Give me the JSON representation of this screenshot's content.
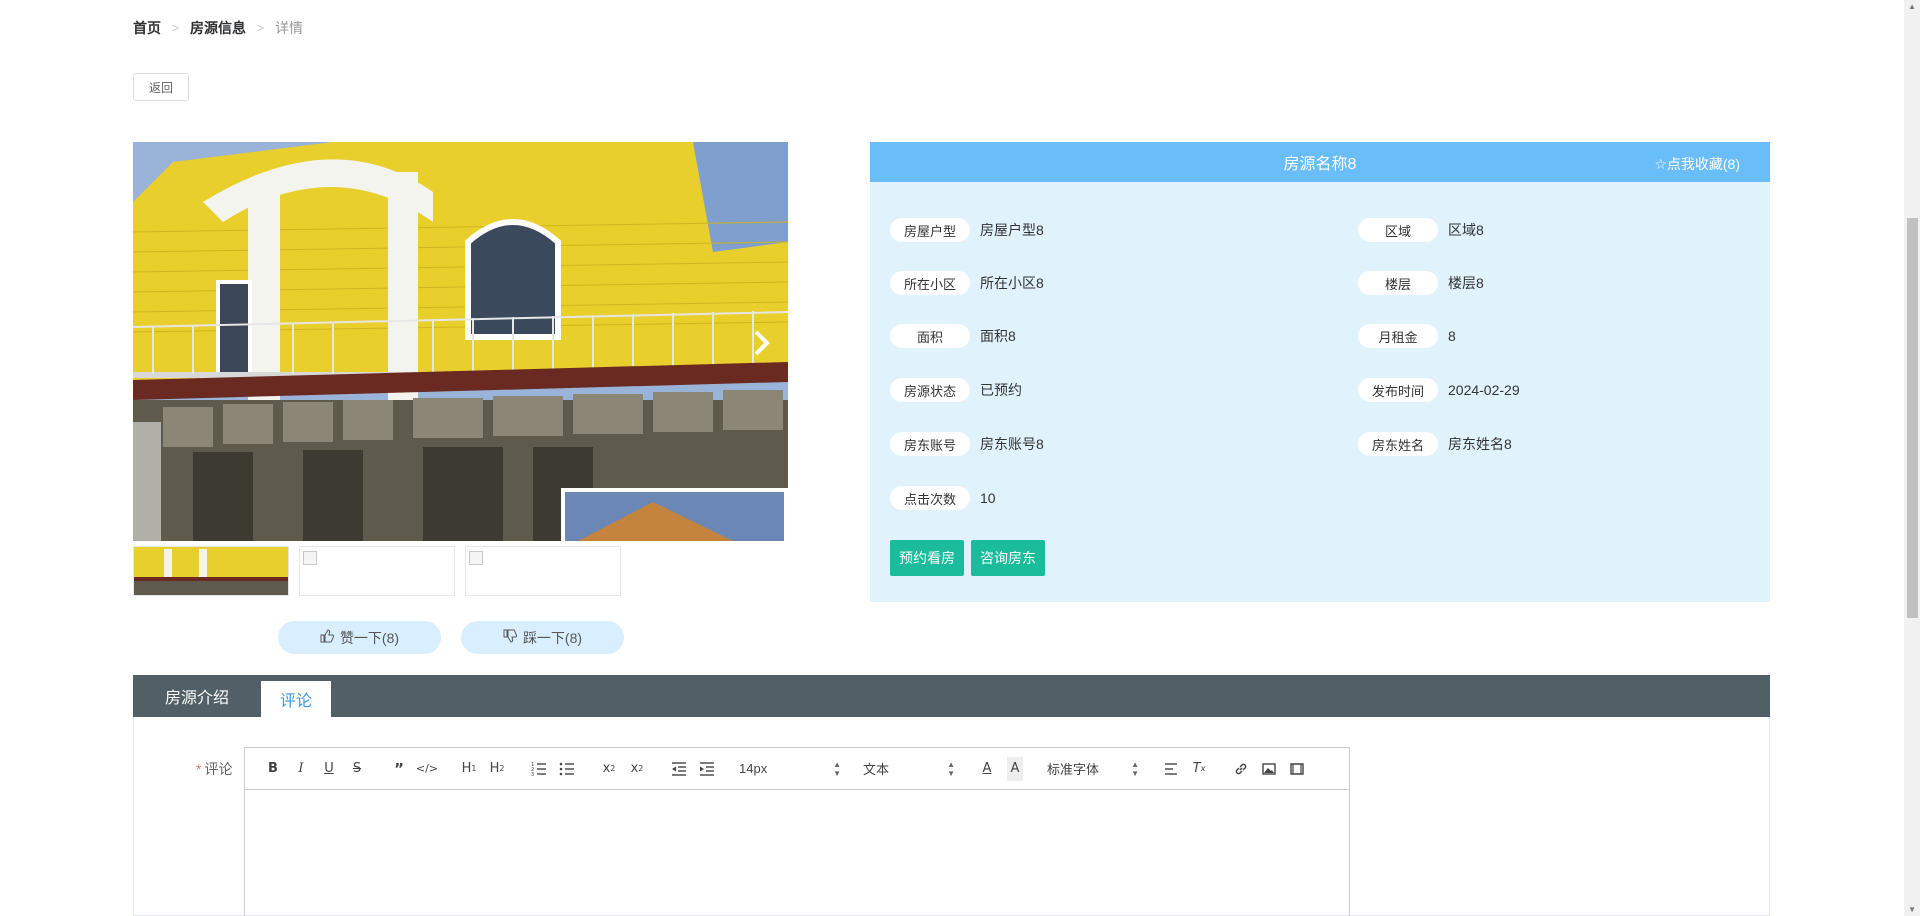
{
  "breadcrumb": {
    "home": "首页",
    "list": "房源信息",
    "current": "详情",
    "separator": ">"
  },
  "back_label": "返回",
  "gallery": {
    "next_icon": "chevron-right-icon"
  },
  "votes": {
    "like_label": "赞一下(8)",
    "dislike_label": "踩一下(8)"
  },
  "info": {
    "title": "房源名称8",
    "favorite_label": "☆点我收藏(8)",
    "fields": [
      {
        "label": "房屋户型",
        "value": "房屋户型8"
      },
      {
        "label": "区域",
        "value": "区域8"
      },
      {
        "label": "所在小区",
        "value": "所在小区8"
      },
      {
        "label": "楼层",
        "value": "楼层8"
      },
      {
        "label": "面积",
        "value": "面积8"
      },
      {
        "label": "月租金",
        "value": "8"
      },
      {
        "label": "房源状态",
        "value": "已预约"
      },
      {
        "label": "发布时间",
        "value": "2024-02-29"
      },
      {
        "label": "房东账号",
        "value": "房东账号8"
      },
      {
        "label": "房东姓名",
        "value": "房东姓名8"
      },
      {
        "label": "点击次数",
        "value": "10"
      }
    ],
    "book_label": "预约看房",
    "consult_label": "咨询房东"
  },
  "tabs": [
    {
      "label": "房源介绍"
    },
    {
      "label": "评论"
    }
  ],
  "comment": {
    "required_mark": "*",
    "label": "评论",
    "toolbar": {
      "size_value": "14px",
      "header_value": "文本",
      "font_value": "标准字体"
    }
  },
  "colors": {
    "header": "#69bdf8",
    "panel": "#e0f3fd",
    "action": "#1abc9c",
    "tabbar": "#515f66",
    "tab_active_text": "#3a9ae8"
  }
}
